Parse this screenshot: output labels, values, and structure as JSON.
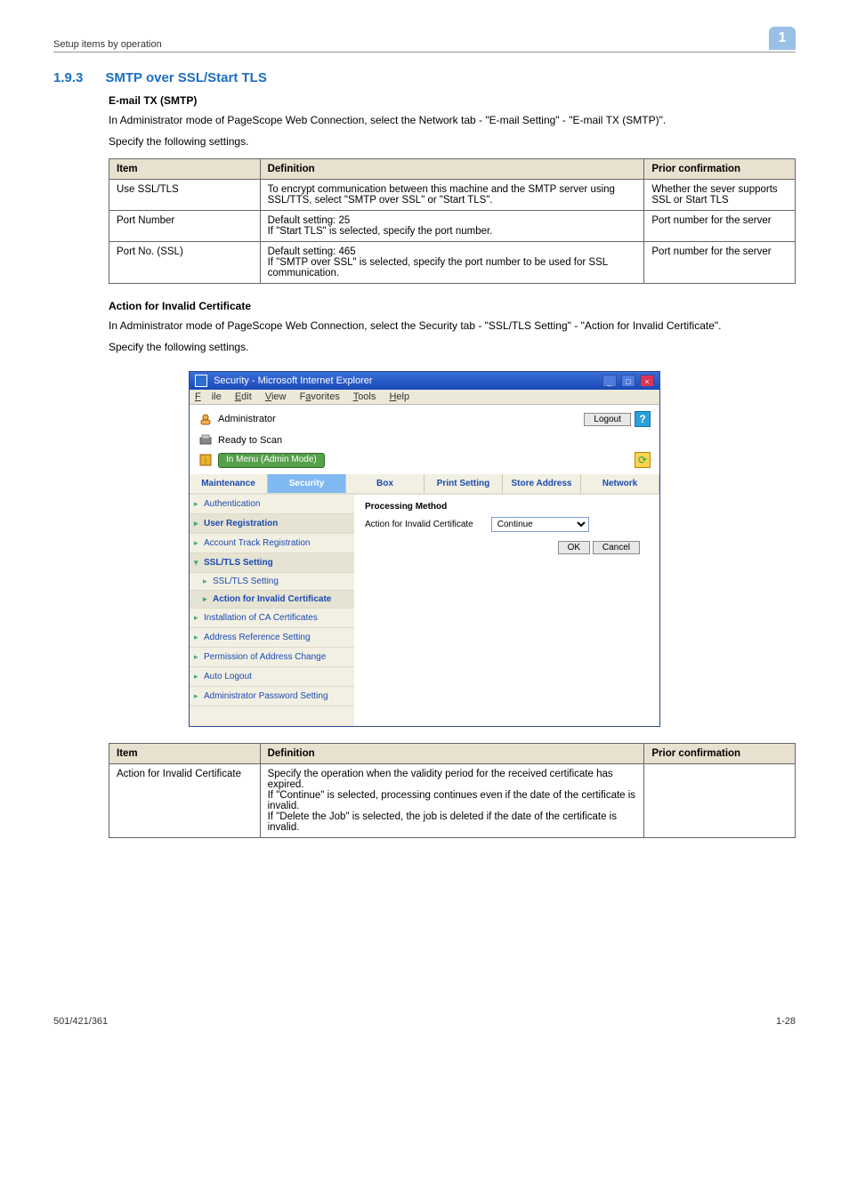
{
  "header": {
    "breadcrumb": "Setup items by operation",
    "page_tab": "1"
  },
  "section": {
    "number": "1.9.3",
    "title": "SMTP over SSL/Start TLS"
  },
  "smtp": {
    "heading": "E-mail TX (SMTP)",
    "para1": "In Administrator mode of PageScope Web Connection, select the Network tab - \"E-mail Setting\" - \"E-mail TX (SMTP)\".",
    "para2": "Specify the following settings.",
    "table": {
      "h1": "Item",
      "h2": "Definition",
      "h3": "Prior confirmation",
      "rows": [
        {
          "c1": "Use SSL/TLS",
          "c2": "To encrypt communication between this machine and the SMTP server using SSL/TTS, select \"SMTP over SSL\" or \"Start TLS\".",
          "c3": "Whether the sever supports SSL or Start TLS"
        },
        {
          "c1": "Port Number",
          "c2": "Default setting: 25\nIf \"Start TLS\" is selected, specify the port number.",
          "c3": "Port number for the server"
        },
        {
          "c1": "Port No. (SSL)",
          "c2": "Default setting: 465\nIf \"SMTP over SSL\" is selected, specify the port number to be used for SSL communication.",
          "c3": "Port number for the server"
        }
      ]
    }
  },
  "action": {
    "heading": "Action for Invalid Certificate",
    "para1": "In Administrator mode of PageScope Web Connection, select the Security tab - \"SSL/TLS Setting\" - \"Action for Invalid Certificate\".",
    "para2": "Specify the following settings.",
    "table": {
      "h1": "Item",
      "h2": "Definition",
      "h3": "Prior confirmation",
      "rows": [
        {
          "c1": "Action for Invalid Certificate",
          "c2": "Specify the operation when the validity period for the received certificate has expired.\nIf \"Continue\" is selected, processing continues even if the date of the certificate is invalid.\nIf \"Delete the Job\" is selected, the job is deleted if the date of the certificate is invalid.",
          "c3": ""
        }
      ]
    }
  },
  "screenshot": {
    "title": "Security - Microsoft Internet Explorer",
    "menu": {
      "file": "File",
      "edit": "Edit",
      "view": "View",
      "favorites": "Favorites",
      "tools": "Tools",
      "help": "Help"
    },
    "hdr": {
      "admin": "Administrator",
      "ready": "Ready to Scan",
      "in_menu": "In Menu (Admin Mode)",
      "logout": "Logout"
    },
    "tabs": {
      "maintenance": "Maintenance",
      "security": "Security",
      "box": "Box",
      "print": "Print Setting",
      "store": "Store Address",
      "network": "Network"
    },
    "sidebar": {
      "auth": "Authentication",
      "userreg": "User Registration",
      "accttrack": "Account Track Registration",
      "ssl": "SSL/TLS Setting",
      "ssl_sub": "SSL/TLS Setting",
      "action_inv": "Action for Invalid Certificate",
      "inst_ca": "Installation of CA Certificates",
      "addr_ref": "Address Reference Setting",
      "perm_addr": "Permission of Address Change",
      "auto_logout": "Auto Logout",
      "admin_pw": "Administrator Password Setting"
    },
    "content": {
      "head": "Processing Method",
      "label": "Action for Invalid Certificate",
      "select": "Continue",
      "ok": "OK",
      "cancel": "Cancel"
    }
  },
  "footer": {
    "left": "501/421/361",
    "right": "1-28"
  }
}
